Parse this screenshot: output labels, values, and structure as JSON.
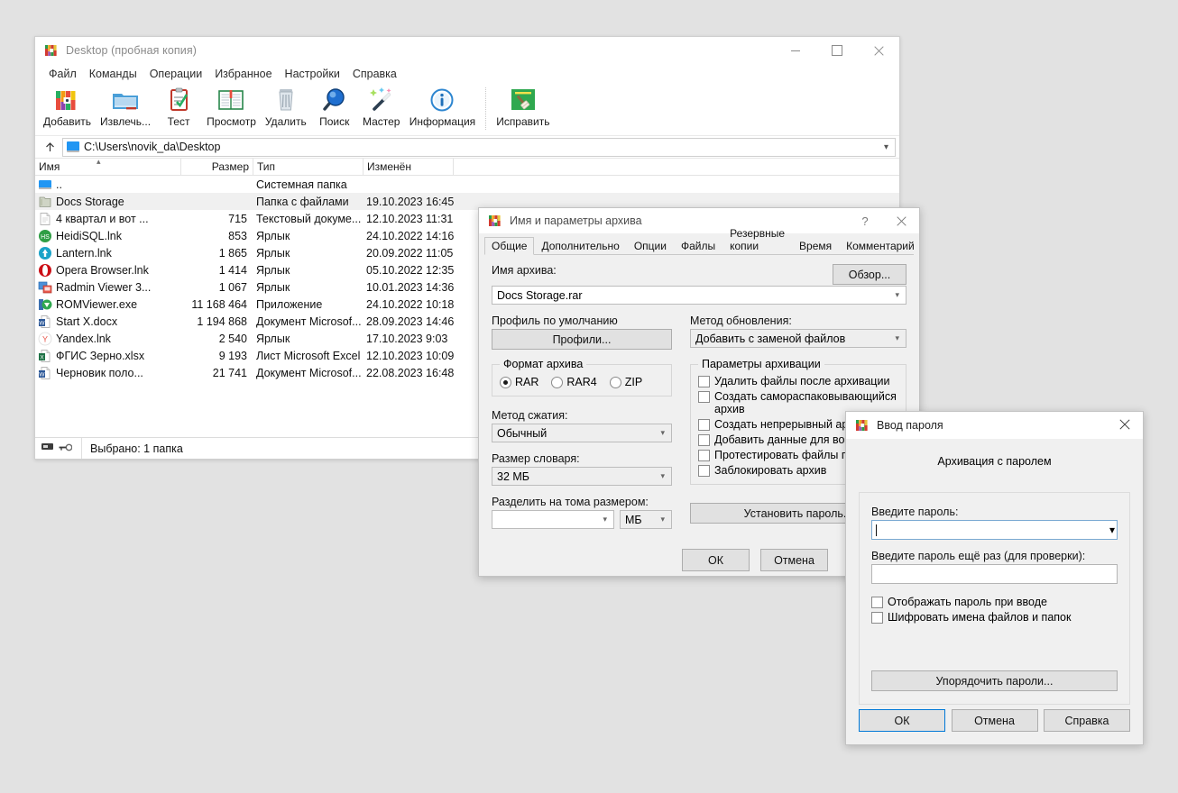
{
  "main_window": {
    "title": "Desktop (пробная копия)",
    "icon": "winrar-icon",
    "window_buttons": {
      "minimize": "minimize-icon",
      "maximize": "maximize-icon",
      "close": "close-icon"
    },
    "menu": [
      "Файл",
      "Команды",
      "Операции",
      "Избранное",
      "Настройки",
      "Справка"
    ],
    "toolbar": [
      {
        "label": "Добавить",
        "icon": "add-archive-icon"
      },
      {
        "label": "Извлечь...",
        "icon": "extract-folder-icon"
      },
      {
        "label": "Тест",
        "icon": "test-clipboard-icon"
      },
      {
        "label": "Просмотр",
        "icon": "view-book-icon"
      },
      {
        "label": "Удалить",
        "icon": "delete-trash-icon"
      },
      {
        "label": "Поиск",
        "icon": "search-magnifier-icon"
      },
      {
        "label": "Мастер",
        "icon": "wizard-wand-icon"
      },
      {
        "label": "Информация",
        "icon": "information-icon"
      },
      {
        "label": "Исправить",
        "icon": "repair-broom-icon"
      }
    ],
    "address": {
      "up_icon": "up-arrow-icon",
      "path": "C:\\Users\\novik_da\\Desktop",
      "chevron": "chevron-down-icon"
    },
    "columns": [
      "Имя",
      "Размер",
      "Тип",
      "Изменён"
    ],
    "sort_indicator": "sort-ascending-icon",
    "files": [
      {
        "name": "..",
        "size": "",
        "type": "Системная папка",
        "modified": "",
        "icon": "parent-folder-icon",
        "selected": false
      },
      {
        "name": "Docs Storage",
        "size": "",
        "type": "Папка с файлами",
        "modified": "19.10.2023 16:45",
        "icon": "folder-icon",
        "selected": true
      },
      {
        "name": "4 квартал и вот ...",
        "size": "715",
        "type": "Текстовый докуме...",
        "modified": "12.10.2023 11:31",
        "icon": "text-file-icon",
        "selected": false
      },
      {
        "name": "HeidiSQL.lnk",
        "size": "853",
        "type": "Ярлык",
        "modified": "24.10.2022 14:16",
        "icon": "heidisql-icon",
        "selected": false
      },
      {
        "name": "Lantern.lnk",
        "size": "1 865",
        "type": "Ярлык",
        "modified": "20.09.2022 11:05",
        "icon": "lantern-icon",
        "selected": false
      },
      {
        "name": "Opera Browser.lnk",
        "size": "1 414",
        "type": "Ярлык",
        "modified": "05.10.2022 12:35",
        "icon": "opera-icon",
        "selected": false
      },
      {
        "name": "Radmin Viewer 3...",
        "size": "1 067",
        "type": "Ярлык",
        "modified": "10.01.2023 14:36",
        "icon": "radmin-icon",
        "selected": false
      },
      {
        "name": "ROMViewer.exe",
        "size": "11 168 464",
        "type": "Приложение",
        "modified": "24.10.2022 10:18",
        "icon": "romviewer-icon",
        "selected": false
      },
      {
        "name": "Start X.docx",
        "size": "1 194 868",
        "type": "Документ Microsof...",
        "modified": "28.09.2023 14:46",
        "icon": "word-icon",
        "selected": false
      },
      {
        "name": "Yandex.lnk",
        "size": "2 540",
        "type": "Ярлык",
        "modified": "17.10.2023 9:03",
        "icon": "yandex-icon",
        "selected": false
      },
      {
        "name": "ФГИС Зерно.xlsx",
        "size": "9 193",
        "type": "Лист Microsoft Excel",
        "modified": "12.10.2023 10:09",
        "icon": "excel-icon",
        "selected": false
      },
      {
        "name": "Черновик поло...",
        "size": "21 741",
        "type": "Документ Microsof...",
        "modified": "22.08.2023 16:48",
        "icon": "word-icon",
        "selected": false
      }
    ],
    "status": {
      "text": "Выбрано: 1 папка",
      "icons": [
        "disk-icon",
        "key-icon"
      ]
    }
  },
  "archive_dialog": {
    "title": "Имя и параметры архива",
    "help_button": "?",
    "close_button": "close-icon",
    "tabs": [
      {
        "label": "Общие",
        "active": true
      },
      {
        "label": "Дополнительно",
        "active": false
      },
      {
        "label": "Опции",
        "active": false
      },
      {
        "label": "Файлы",
        "active": false
      },
      {
        "label": "Резервные копии",
        "active": false
      },
      {
        "label": "Время",
        "active": false
      },
      {
        "label": "Комментарий",
        "active": false
      }
    ],
    "archive_name_label": "Имя архива:",
    "archive_name_value": "Docs Storage.rar",
    "browse_button": "Обзор...",
    "profile_label": "Профиль по умолчанию",
    "profiles_button": "Профили...",
    "update_method_label": "Метод обновления:",
    "update_method_value": "Добавить с заменой файлов",
    "format_group": "Формат архива",
    "format_options": [
      {
        "label": "RAR",
        "checked": true
      },
      {
        "label": "RAR4",
        "checked": false
      },
      {
        "label": "ZIP",
        "checked": false
      }
    ],
    "compression_label": "Метод сжатия:",
    "compression_value": "Обычный",
    "dictionary_label": "Размер словаря:",
    "dictionary_value": "32 МБ",
    "split_label": "Разделить на тома размером:",
    "split_value": "",
    "split_unit": "МБ",
    "options_group": "Параметры архивации",
    "options": [
      {
        "label": "Удалить файлы после архивации",
        "checked": false
      },
      {
        "label": "Создать самораспаковывающийся архив",
        "checked": false
      },
      {
        "label": "Создать непрерывный архив",
        "checked": false
      },
      {
        "label": "Добавить данные для восстано",
        "checked": false
      },
      {
        "label": "Протестировать файлы после а",
        "checked": false
      },
      {
        "label": "Заблокировать архив",
        "checked": false
      }
    ],
    "set_password_button": "Установить пароль...",
    "ok_button": "ОК",
    "cancel_button": "Отмена"
  },
  "password_dialog": {
    "title": "Ввод пароля",
    "close_button": "close-icon",
    "heading": "Архивация с паролем",
    "password_label": "Введите пароль:",
    "password_value": "",
    "password_chevron": "chevron-down-icon",
    "confirm_label": "Введите пароль ещё раз (для проверки):",
    "confirm_value": "",
    "checkboxes": [
      {
        "label": "Отображать пароль при вводе",
        "checked": false
      },
      {
        "label": "Шифровать имена файлов и папок",
        "checked": false
      }
    ],
    "organize_button": "Упорядочить пароли...",
    "ok_button": "ОК",
    "cancel_button": "Отмена",
    "help_button": "Справка"
  },
  "colors": {
    "desktop_background": "#e2e2e2",
    "window_background": "#ffffff",
    "dialog_background": "#f0f0f0",
    "accent": "#0078d7",
    "selection": "#f0f0f0",
    "title_text": "#8a8a8a"
  }
}
